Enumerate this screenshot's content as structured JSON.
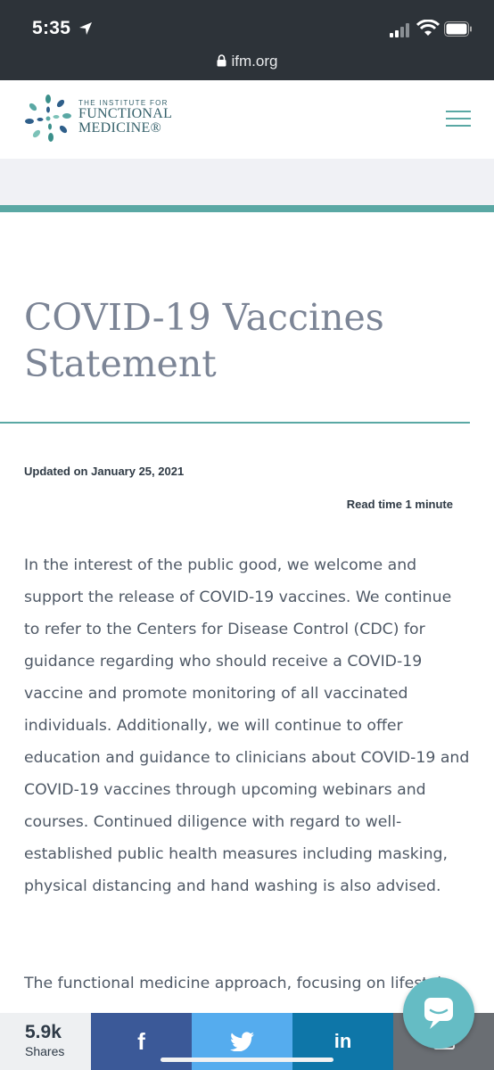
{
  "status_bar": {
    "time": "5:35",
    "url": "ifm.org"
  },
  "header": {
    "logo_line1": "THE INSTITUTE FOR",
    "logo_line2": "FUNCTIONAL",
    "logo_line3": "MEDICINE®"
  },
  "article": {
    "title": "COVID-19 Vaccines Statement",
    "updated": "Updated on January 25, 2021",
    "read_time": "Read time 1 minute",
    "paragraphs": [
      "In the interest of the public good, we welcome and support the release of COVID-19 vaccines.  We continue to refer to the Centers for Disease Control (CDC) for guidance regarding who should receive a COVID-19 vaccine and promote monitoring of all vaccinated individuals.  Additionally, we will continue to offer education and guidance to clinicians about COVID-19 and COVID-19 vaccines through upcoming webinars and courses.  Continued diligence with regard to well-established public health measures including masking, physical distancing and hand washing is also advised.",
      "The functional medicine approach, focusing on lifestyle"
    ]
  },
  "share_bar": {
    "count": "5.9k",
    "label": "Shares",
    "facebook": "f",
    "linkedin": "in"
  },
  "colors": {
    "teal": "#5aa8a4",
    "title": "#7c8596",
    "body_text": "#4f5966",
    "status_bg": "#2d3339"
  }
}
